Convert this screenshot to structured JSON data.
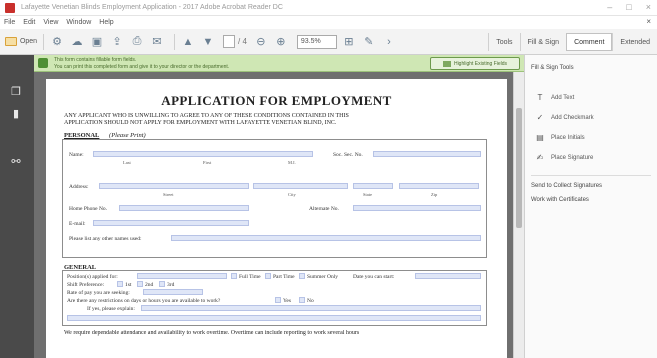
{
  "window": {
    "title": "Lafayette Venetian Blinds Employment Application - 2017 Adobe Acrobat Reader DC",
    "minimize": "–",
    "maximize": "□",
    "close": "×"
  },
  "menu": {
    "items": [
      "File",
      "Edit",
      "View",
      "Window",
      "Help"
    ],
    "close_doc": "×"
  },
  "toolbar": {
    "open_label": "Open",
    "page_current": "1",
    "page_total": "/ 4",
    "zoom": "93.5%",
    "tabs": [
      "Tools",
      "Fill & Sign",
      "Comment",
      "Extended"
    ],
    "active_tab": "Comment"
  },
  "notification": {
    "line1": "This form contains fillable form fields.",
    "line2": "You can print this completed form and give it to your director or the department.",
    "button": "Highlight Existing Fields"
  },
  "document": {
    "title": "APPLICATION FOR EMPLOYMENT",
    "intro_line1": "ANY APPLICANT WHO IS UNWILLING TO AGREE TO ANY OF THESE CONDITIONS CONTAINED IN THIS",
    "intro_line2": "APPLICATION SHOULD NOT APPLY FOR EMPLOYMENT WITH LAFAYETTE VENETIAN BLIND, INC.",
    "personal_heading": "PERSONAL",
    "personal_hint": "(Please Print)",
    "name_label": "Name:",
    "ssn_label": "Soc. Sec. No.",
    "name_sub": [
      "Last",
      "First",
      "M.I."
    ],
    "address_label": "Address:",
    "address_sub": [
      "Street",
      "City",
      "State",
      "Zip"
    ],
    "home_phone_label": "Home Phone No.",
    "alt_phone_label": "Alternate No.",
    "email_label": "E-mail:",
    "other_names_label": "Please list any other names used:",
    "general_heading": "GENERAL",
    "position_label": "Position(s) applied for:",
    "full_time": "Full Time",
    "part_time": "Part Time",
    "summer_only": "Summer Only",
    "date_start_label": "Date you can start:",
    "shift_label": "Shift Preference:",
    "shifts": [
      "1st",
      "2nd",
      "3rd"
    ],
    "pay_label": "Rate of pay you are seeking:",
    "restrictions_label": "Are there any restrictions on days or hours you are available to work?",
    "yes": "Yes",
    "no": "No",
    "explain_label": "If yes, please explain:",
    "closing": "We require dependable attendance and availability to work overtime. Overtime can include reporting to work several hours"
  },
  "tools_pane": {
    "header": "Fill & Sign Tools",
    "items": [
      {
        "icon": "T",
        "label": "Add Text"
      },
      {
        "icon": "✓",
        "label": "Add Checkmark"
      },
      {
        "icon": "▤",
        "label": "Place Initials"
      },
      {
        "icon": "✍",
        "label": "Place Signature"
      }
    ],
    "send_label": "Send to Collect Signatures",
    "certify_label": "Work with Certificates"
  }
}
